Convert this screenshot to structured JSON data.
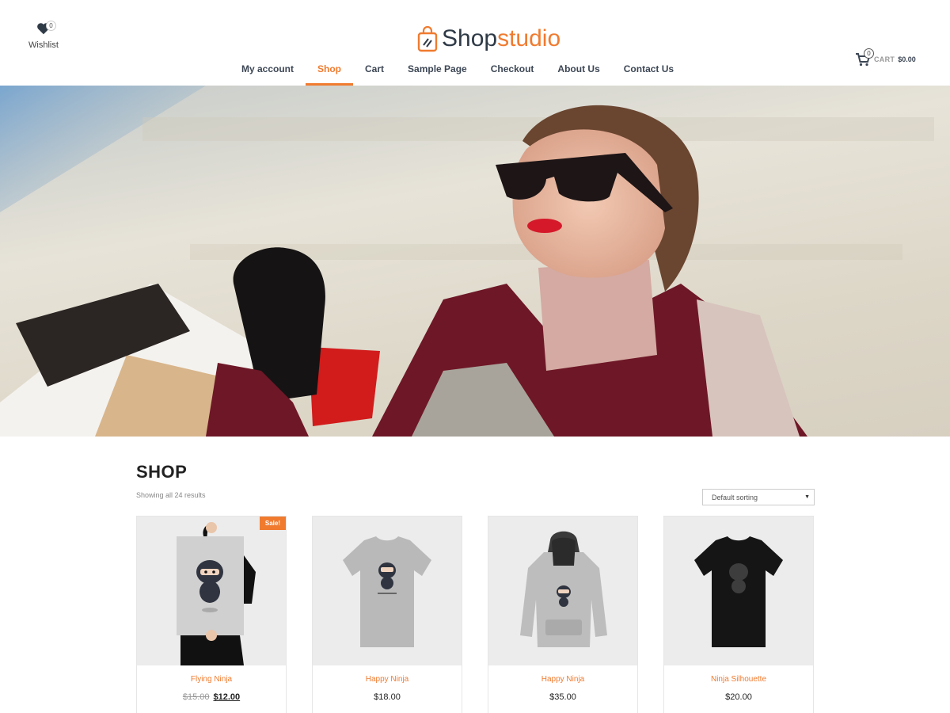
{
  "header": {
    "wishlist": {
      "label": "Wishlist",
      "count": "0"
    },
    "logo": {
      "part1": "Shop",
      "part2": "studio"
    },
    "nav": [
      {
        "label": "My account"
      },
      {
        "label": "Shop"
      },
      {
        "label": "Cart"
      },
      {
        "label": "Sample Page"
      },
      {
        "label": "Checkout"
      },
      {
        "label": "About Us"
      },
      {
        "label": "Contact Us"
      }
    ],
    "active_nav": "Shop",
    "cart": {
      "count": "0",
      "label": "CART",
      "amount": "$0.00"
    }
  },
  "shop": {
    "title": "SHOP",
    "result_count": "Showing all 24 results",
    "sorting": "Default sorting"
  },
  "products": [
    {
      "name": "Flying Ninja",
      "old_price": "$15.00",
      "price": "$12.00",
      "sale_badge": "Sale!"
    },
    {
      "name": "Happy Ninja",
      "price": "$18.00"
    },
    {
      "name": "Happy Ninja",
      "price": "$35.00"
    },
    {
      "name": "Ninja Silhouette",
      "price": "$20.00"
    }
  ],
  "colors": {
    "accent": "#f07b2f",
    "text_dark": "#3c4654"
  }
}
